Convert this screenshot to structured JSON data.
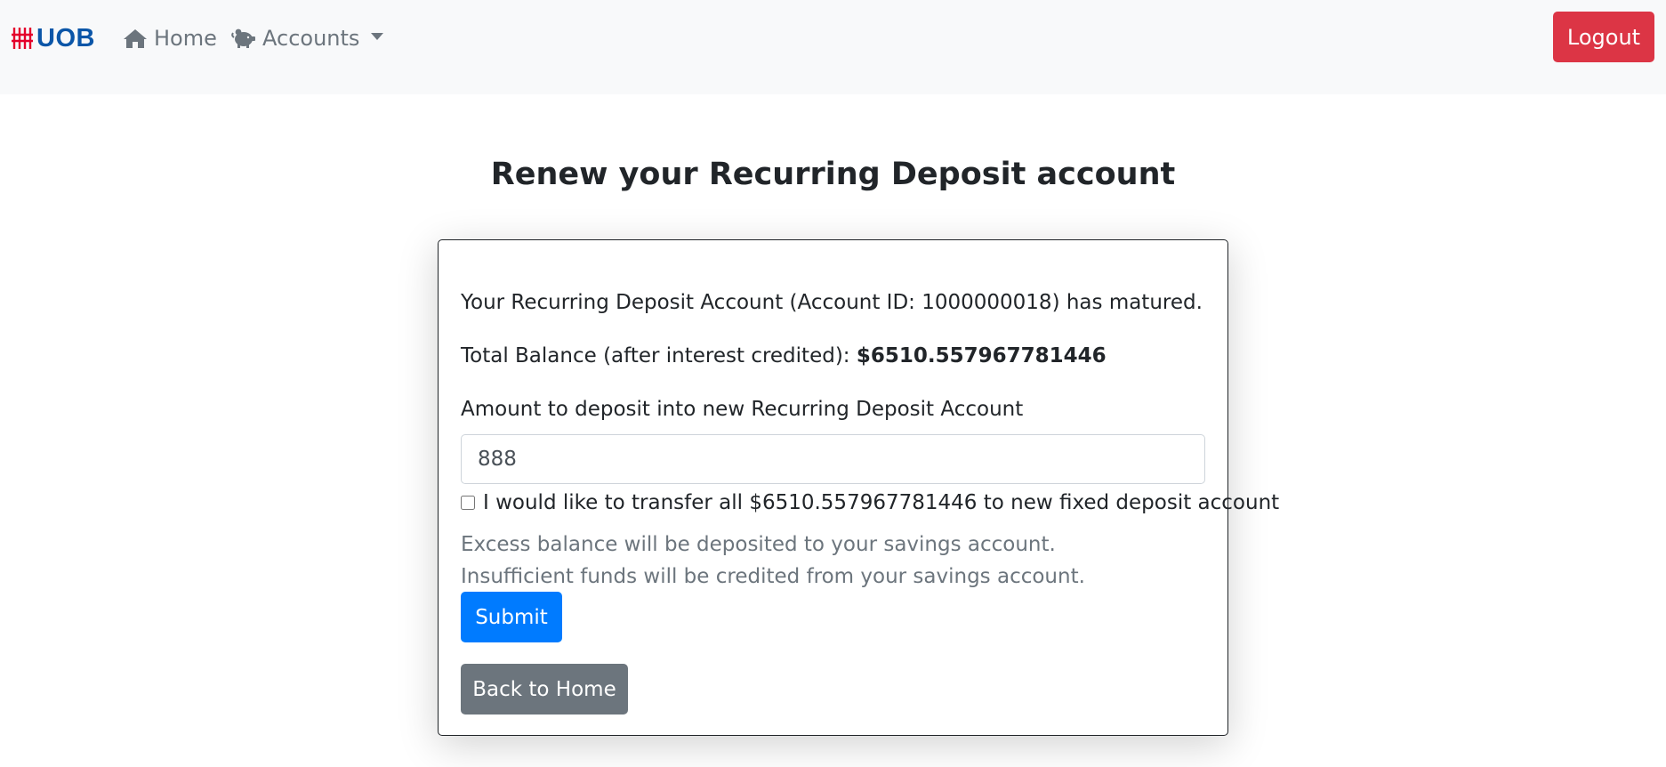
{
  "navbar": {
    "brand": "UOB",
    "brand_color": "#0b56a8",
    "home_label": "Home",
    "home_icon": "home-icon",
    "accounts_label": "Accounts",
    "accounts_icon": "piggy-bank-icon",
    "logout_label": "Logout",
    "logout_color": "#dc3545"
  },
  "page": {
    "title": "Renew your Recurring Deposit account"
  },
  "form": {
    "matured_text": "Your Recurring Deposit Account (Account ID: 1000000018) has matured.",
    "balance_prefix": "Total Balance (after interest credited): ",
    "balance_value": "$6510.557967781446",
    "amount_label": "Amount to deposit into new Recurring Deposit Account",
    "amount_value": "888",
    "transfer_all_label": "I would like to transfer all $6510.557967781446 to new fixed deposit account",
    "transfer_all_checked": false,
    "note_excess": "Excess balance will be deposited to your savings account.",
    "note_insufficient": "Insufficient funds will be credited from your savings account.",
    "submit_label": "Submit",
    "submit_color": "#007bff",
    "back_label": "Back to Home",
    "back_color": "#6c757d"
  }
}
